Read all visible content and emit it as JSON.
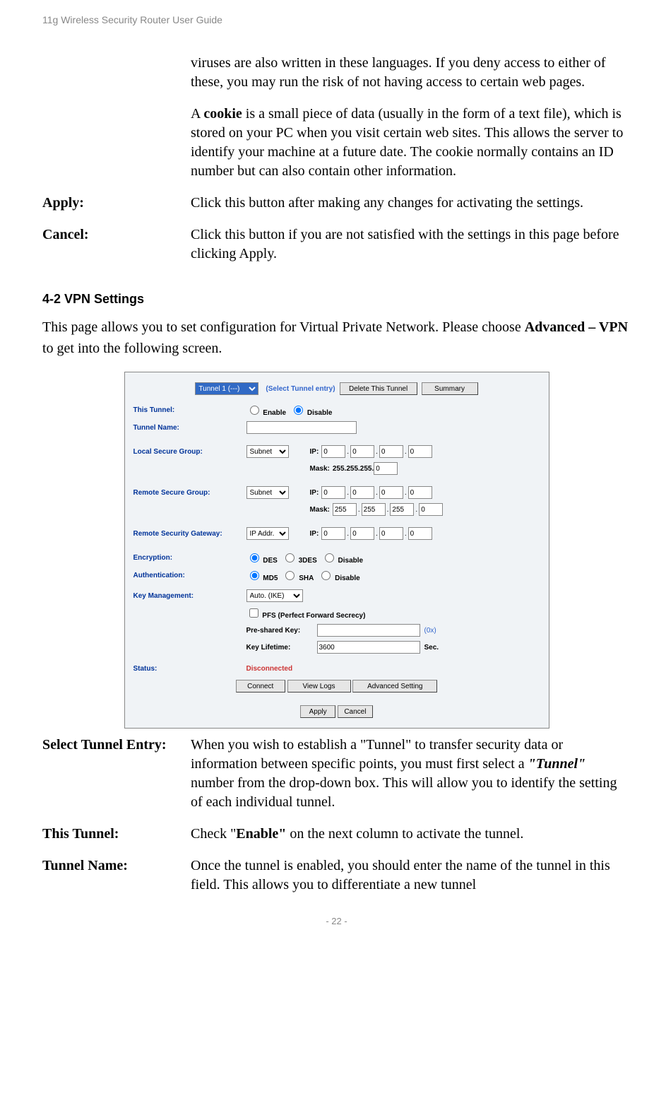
{
  "header": {
    "title": "11g Wireless Security Router User Guide"
  },
  "intro": {
    "viruses_para": "viruses are also written in these languages. If you deny access to either of these, you may run the risk of not having access to certain web pages.",
    "cookie_para_pre": "A ",
    "cookie_bold": "cookie",
    "cookie_para_post": " is a small piece of data (usually in the form of a text file), which is stored on your PC when you visit certain web sites. This allows the server to identify your machine at a future date. The cookie normally contains an ID number but can also contain other information."
  },
  "rows": {
    "apply_label": "Apply:",
    "apply_desc": "Click this button after making any changes for activating the settings.",
    "cancel_label": "Cancel:",
    "cancel_desc": "Click this button if you are not satisfied with the settings in this page before clicking Apply."
  },
  "section": {
    "heading": "4-2 VPN Settings",
    "para_pre": "This page allows you to set configuration for Virtual Private Network. Please choose ",
    "para_bold": "Advanced – VPN",
    "para_post": " to get into the following screen."
  },
  "panel": {
    "tunnel_select_option": "Tunnel 1  (---)",
    "select_hint": "(Select Tunnel entry)",
    "btn_delete": "Delete This Tunnel",
    "btn_summary": "Summary",
    "this_tunnel_label": "This Tunnel:",
    "enable": "Enable",
    "disable": "Disable",
    "tunnel_name_label": "Tunnel Name:",
    "tunnel_name_value": "",
    "local_secure_label": "Local Secure Group:",
    "subnet_option": "Subnet",
    "ip_label": "IP:",
    "mask_label": "Mask:",
    "mask_prefix": "255.255.255.",
    "remote_secure_label": "Remote Secure Group:",
    "remote_gateway_label": "Remote Security Gateway:",
    "ipaddr_option": "IP Addr.",
    "encryption_label": "Encryption:",
    "des": "DES",
    "tdes": "3DES",
    "auth_label": "Authentication:",
    "md5": "MD5",
    "sha": "SHA",
    "keymgmt_label": "Key Management:",
    "keymgmt_option": "Auto. (IKE)",
    "pfs_label": "PFS (Perfect Forward Secrecy)",
    "presharedkey_label": "Pre-shared Key:",
    "presharedkey_value": "",
    "presharedkey_suffix": "(0x)",
    "keylifetime_label": "Key Lifetime:",
    "keylifetime_value": "3600",
    "keylifetime_suffix": "Sec.",
    "status_label": "Status:",
    "status_value": "Disconnected",
    "btn_connect": "Connect",
    "btn_viewlogs": "View Logs",
    "btn_advanced": "Advanced Setting",
    "btn_apply": "Apply",
    "btn_cancel": "Cancel",
    "ip": {
      "o1": "0",
      "o2": "0",
      "o3": "0",
      "o4": "0"
    },
    "mask255": "255"
  },
  "after": {
    "sel_label": "Select Tunnel Entry:",
    "sel_pre": "When you wish to establish a \"Tunnel\" to transfer security data or information between specific points, you must first select a ",
    "sel_bold": "\"Tunnel\"",
    "sel_post": " number from the drop-down box. This will allow you to identify the setting of each individual tunnel.",
    "this_label": "This Tunnel:",
    "this_pre": "Check \"",
    "this_bold": "Enable\"",
    "this_post": " on the next column to activate the tunnel.",
    "name_label": "Tunnel Name:",
    "name_desc": "Once the tunnel is enabled, you should enter the name of the tunnel in this field. This allows you to differentiate a new tunnel"
  },
  "footer": {
    "pagenum": "- 22 -"
  }
}
